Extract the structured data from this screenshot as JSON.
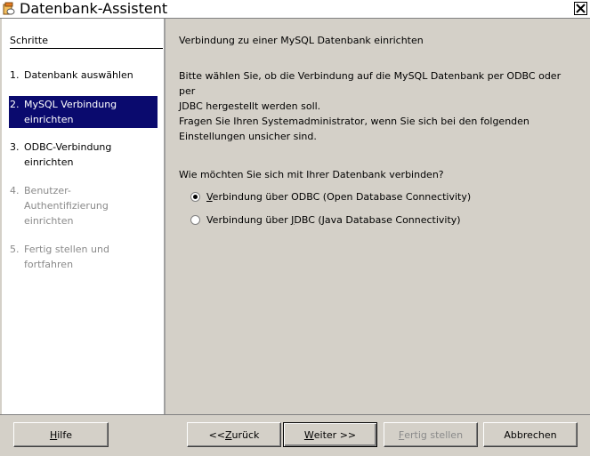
{
  "window": {
    "title": "Datenbank-Assistent"
  },
  "sidebar": {
    "header": "Schritte",
    "steps": [
      {
        "num": "1.",
        "label": "Datenbank auswählen"
      },
      {
        "num": "2.",
        "label": "MySQL Verbindung einrichten"
      },
      {
        "num": "3.",
        "label": "ODBC-Verbindung einrichten"
      },
      {
        "num": "4.",
        "label": "Benutzer-Authentifizierung einrichten"
      },
      {
        "num": "5.",
        "label": "Fertig stellen und fortfahren"
      }
    ]
  },
  "main": {
    "heading": "Verbindung zu einer MySQL Datenbank einrichten",
    "desc_line1": "Bitte wählen Sie, ob die Verbindung auf die MySQL Datenbank per ODBC oder per",
    "desc_line2": "JDBC hergestellt werden soll.",
    "desc_line3": "Fragen Sie Ihren Systemadministrator, wenn Sie sich bei den folgenden",
    "desc_line4": "Einstellungen unsicher sind.",
    "question": "Wie möchten Sie sich mit Ihrer Datenbank verbinden?",
    "options": [
      {
        "prefix": "",
        "mnemonic": "V",
        "rest": "erbindung über ODBC (Open Database Connectivity)",
        "checked": true
      },
      {
        "prefix": "Verbindung über ",
        "mnemonic": "J",
        "rest": "DBC (Java Database Connectivity)",
        "checked": false
      }
    ]
  },
  "buttons": {
    "help_mnemonic": "H",
    "help_rest": "ilfe",
    "back_prefix": "<< ",
    "back_mnemonic": "Z",
    "back_rest": "urück",
    "next_mnemonic": "W",
    "next_rest": "eiter >>",
    "finish_mnemonic": "F",
    "finish_rest": "ertig stellen",
    "cancel_label": "Abbrechen"
  }
}
